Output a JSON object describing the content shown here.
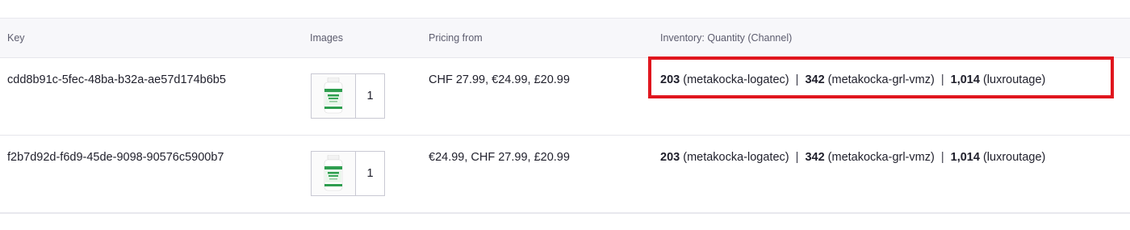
{
  "columns": {
    "key": "Key",
    "images": "Images",
    "pricing": "Pricing from",
    "inventory": "Inventory: Quantity (Channel)"
  },
  "rows": [
    {
      "key": "cdd8b91c-5fec-48ba-b32a-ae57d174b6b5",
      "image_count": "1",
      "pricing": "CHF 27.99, €24.99, £20.99",
      "inventory": [
        {
          "qty": "203",
          "channel": "(metakocka-logatec)"
        },
        {
          "qty": "342",
          "channel": "(metakocka-grl-vmz)"
        },
        {
          "qty": "1,014",
          "channel": "(luxroutage)"
        }
      ],
      "highlighted": true
    },
    {
      "key": "f2b7d92d-f6d9-45de-9098-90576c5900b7",
      "image_count": "1",
      "pricing": "€24.99, CHF 27.99, £20.99",
      "inventory": [
        {
          "qty": "203",
          "channel": "(metakocka-logatec)"
        },
        {
          "qty": "342",
          "channel": "(metakocka-grl-vmz)"
        },
        {
          "qty": "1,014",
          "channel": "(luxroutage)"
        }
      ],
      "highlighted": false
    }
  ],
  "separator": "|",
  "colors": {
    "highlight": "#e0161e",
    "header_bg": "#f7f7fa",
    "bottle_label": "#2e9e4f"
  },
  "icons": {
    "product_thumbnail": "vitamin-bottle-icon"
  }
}
